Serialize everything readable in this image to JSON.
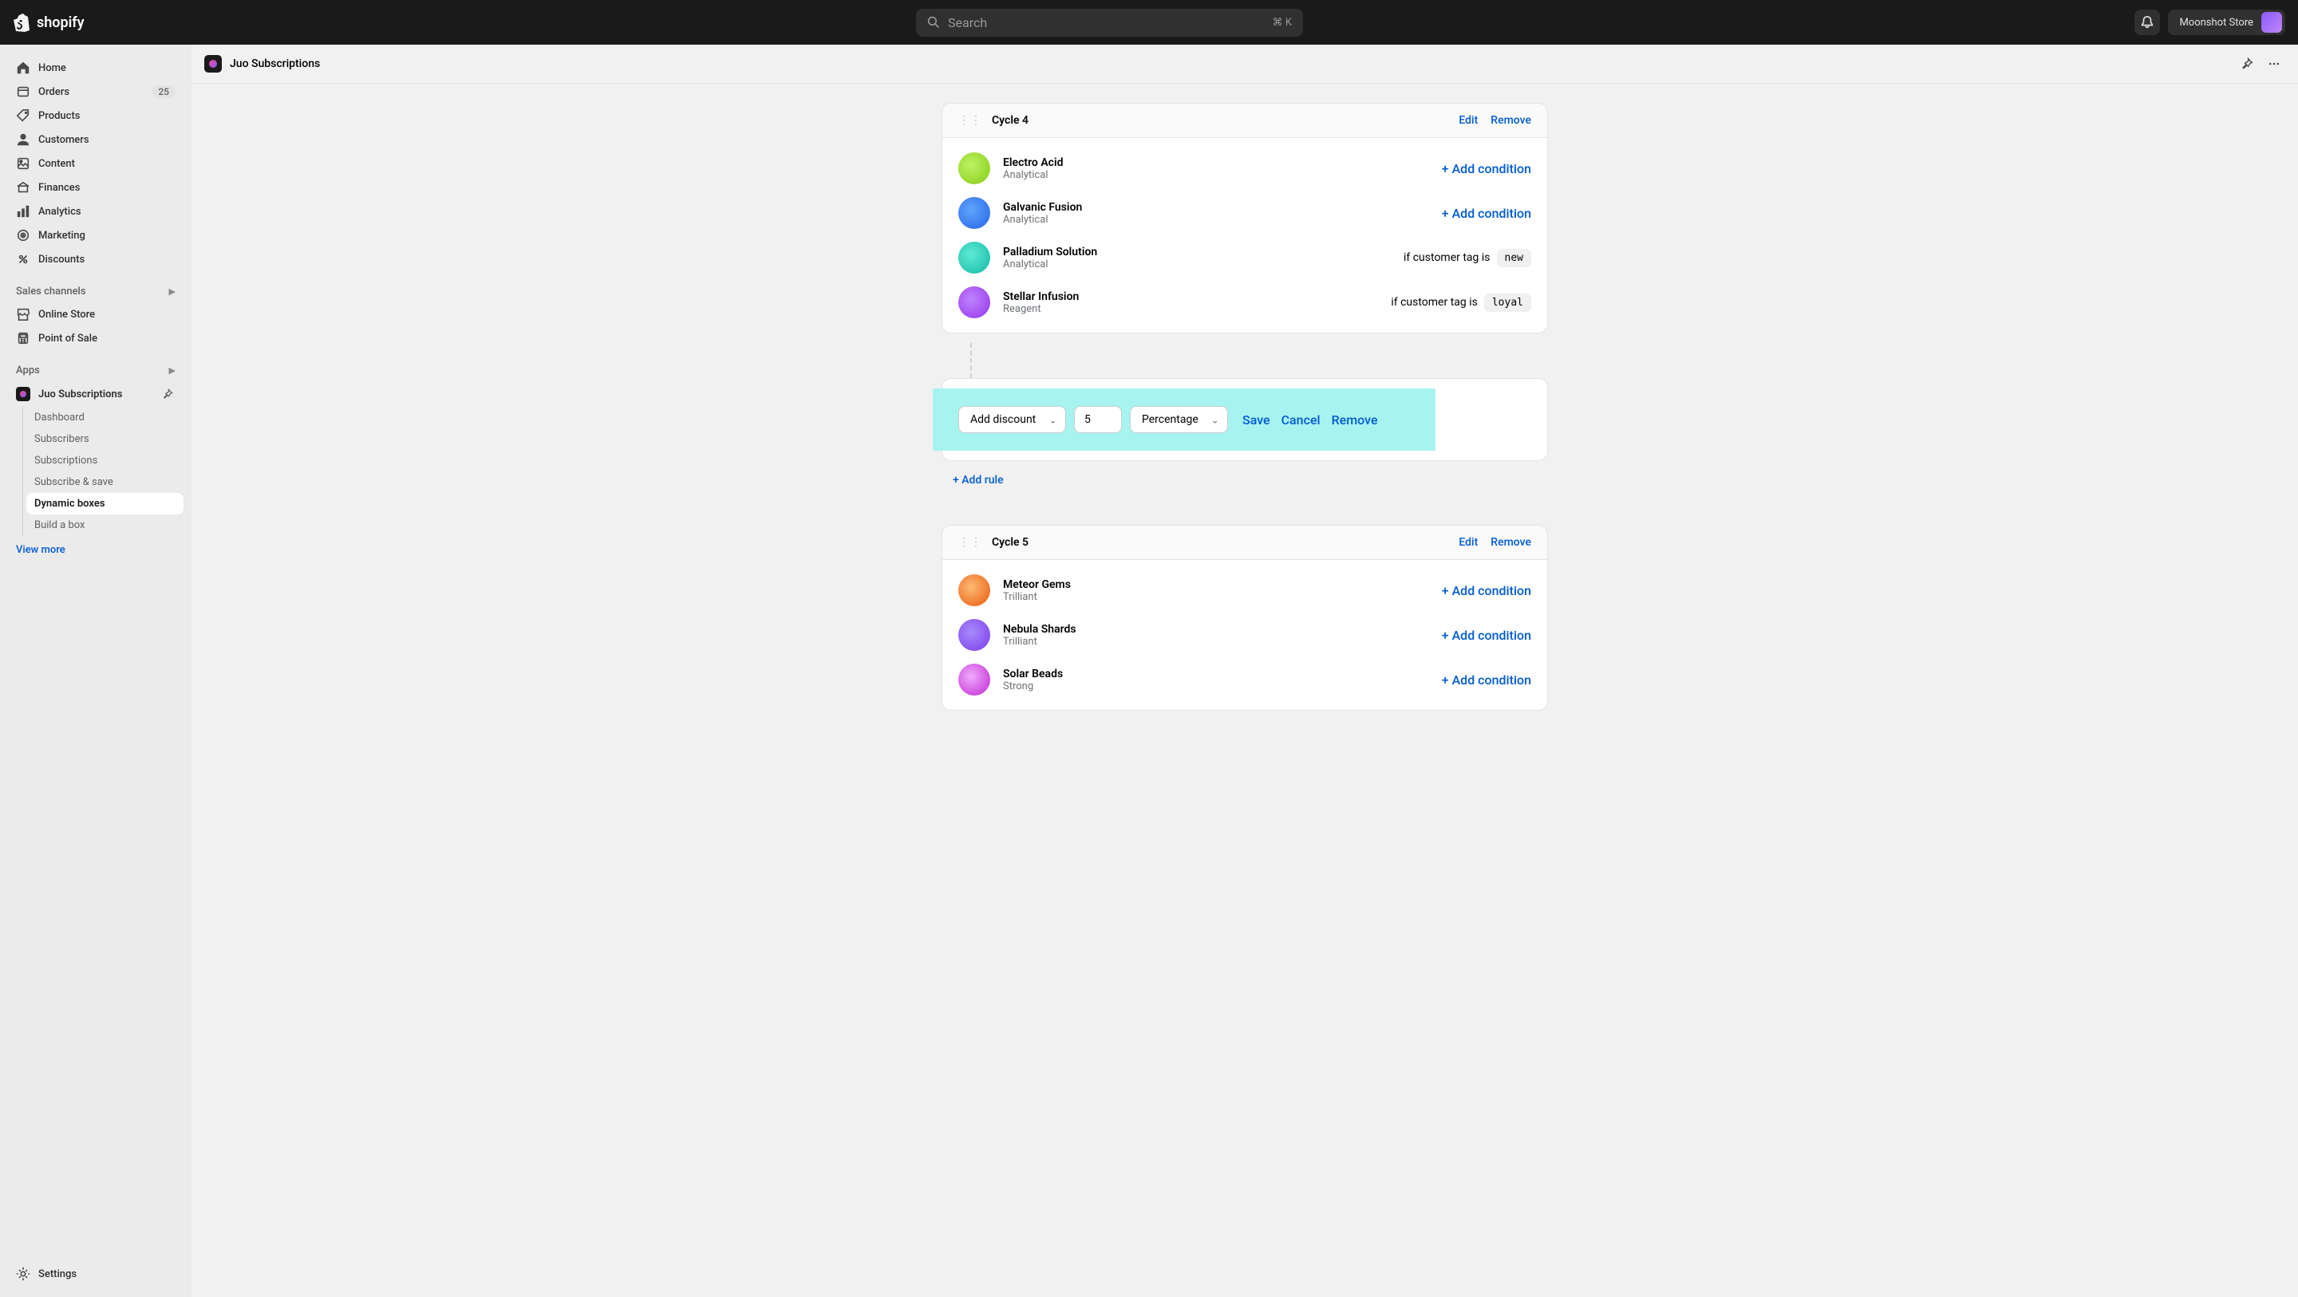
{
  "header": {
    "brand": "shopify",
    "search_placeholder": "Search",
    "shortcut": "⌘ K",
    "store_name": "Moonshot Store"
  },
  "sidebar": {
    "nav": [
      {
        "label": "Home"
      },
      {
        "label": "Orders",
        "badge": "25"
      },
      {
        "label": "Products"
      },
      {
        "label": "Customers"
      },
      {
        "label": "Content"
      },
      {
        "label": "Finances"
      },
      {
        "label": "Analytics"
      },
      {
        "label": "Marketing"
      },
      {
        "label": "Discounts"
      }
    ],
    "sales_channels_label": "Sales channels",
    "channels": [
      {
        "label": "Online Store"
      },
      {
        "label": "Point of Sale"
      }
    ],
    "apps_label": "Apps",
    "app_name": "Juo Subscriptions",
    "app_subitems": [
      {
        "label": "Dashboard"
      },
      {
        "label": "Subscribers"
      },
      {
        "label": "Subscriptions"
      },
      {
        "label": "Subscribe & save"
      },
      {
        "label": "Dynamic boxes",
        "active": true
      },
      {
        "label": "Build a box"
      }
    ],
    "view_more": "View more",
    "settings": "Settings"
  },
  "page": {
    "title": "Juo Subscriptions"
  },
  "cycles": [
    {
      "title": "Cycle 4",
      "edit": "Edit",
      "remove": "Remove",
      "products": [
        {
          "name": "Electro Acid",
          "sub": "Analytical",
          "action": "+ Add condition",
          "action_type": "link",
          "avatar": "green"
        },
        {
          "name": "Galvanic Fusion",
          "sub": "Analytical",
          "action": "+ Add condition",
          "action_type": "link",
          "avatar": "blue"
        },
        {
          "name": "Palladium Solution",
          "sub": "Analytical",
          "condition_prefix": "if customer tag is",
          "tag": "new",
          "action_type": "condition",
          "avatar": "teal"
        },
        {
          "name": "Stellar Infusion",
          "sub": "Reagent",
          "condition_prefix": "if customer tag is",
          "tag": "loyal",
          "action_type": "condition",
          "avatar": "purple"
        }
      ]
    },
    {
      "title": "Cycle 5",
      "edit": "Edit",
      "remove": "Remove",
      "products": [
        {
          "name": "Meteor Gems",
          "sub": "Trilliant",
          "action": "+ Add condition",
          "action_type": "link",
          "avatar": "orange"
        },
        {
          "name": "Nebula Shards",
          "sub": "Trilliant",
          "action": "+ Add condition",
          "action_type": "link",
          "avatar": "violet"
        },
        {
          "name": "Solar Beads",
          "sub": "Strong",
          "action": "+ Add condition",
          "action_type": "link",
          "avatar": "magenta"
        }
      ]
    }
  ],
  "discount_editor": {
    "type_label": "Add discount",
    "value": "5",
    "unit_label": "Percentage",
    "save": "Save",
    "cancel": "Cancel",
    "remove": "Remove"
  },
  "add_rule": "+ Add rule"
}
